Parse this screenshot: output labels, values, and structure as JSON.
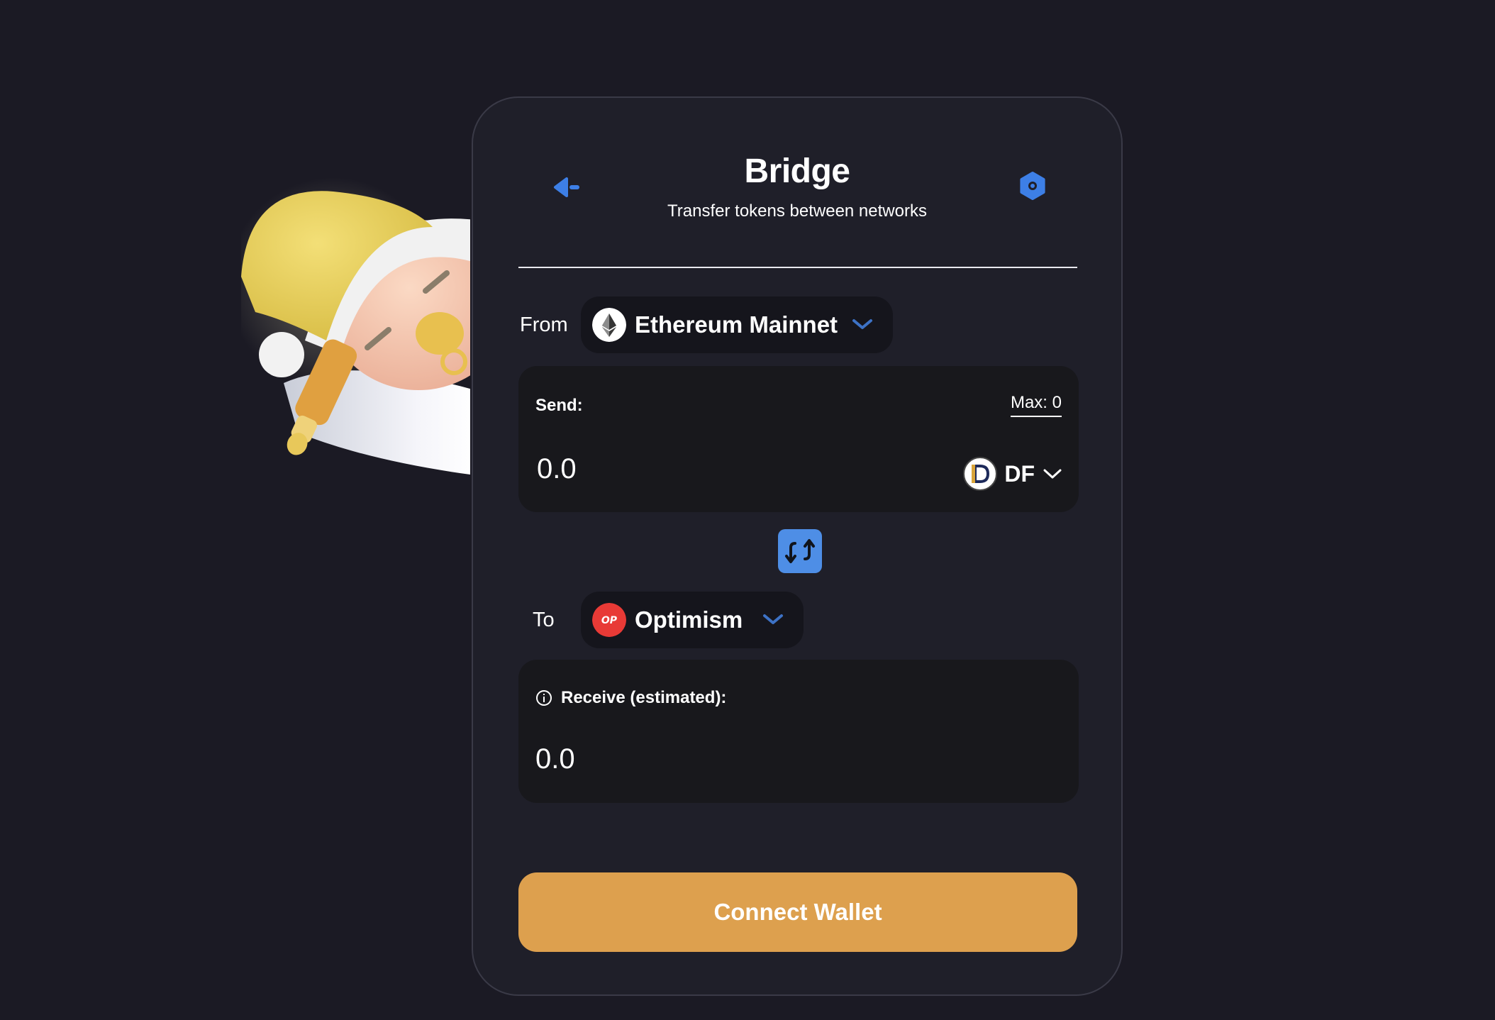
{
  "header": {
    "title": "Bridge",
    "subtitle": "Transfer tokens between networks",
    "back_icon": "back-arrow-icon",
    "settings_icon": "gear-icon"
  },
  "from": {
    "label": "From",
    "network": "Ethereum Mainnet",
    "network_icon": "ethereum-icon"
  },
  "send": {
    "label": "Send:",
    "max_label": "Max: 0",
    "amount_placeholder": "0.0",
    "token": "DF",
    "token_icon": "df-token-icon"
  },
  "to": {
    "label": "To",
    "network": "Optimism",
    "network_icon": "optimism-icon",
    "network_icon_text": "OP"
  },
  "receive": {
    "label": "Receive (estimated):",
    "amount": "0.0"
  },
  "connect_button": "Connect Wallet",
  "colors": {
    "background": "#1b1a24",
    "card": "#1f1f29",
    "panel": "#18181c",
    "accent_blue": "#4e8ee6",
    "connect_orange": "#dda04e",
    "optimism_red": "#e83a36"
  }
}
